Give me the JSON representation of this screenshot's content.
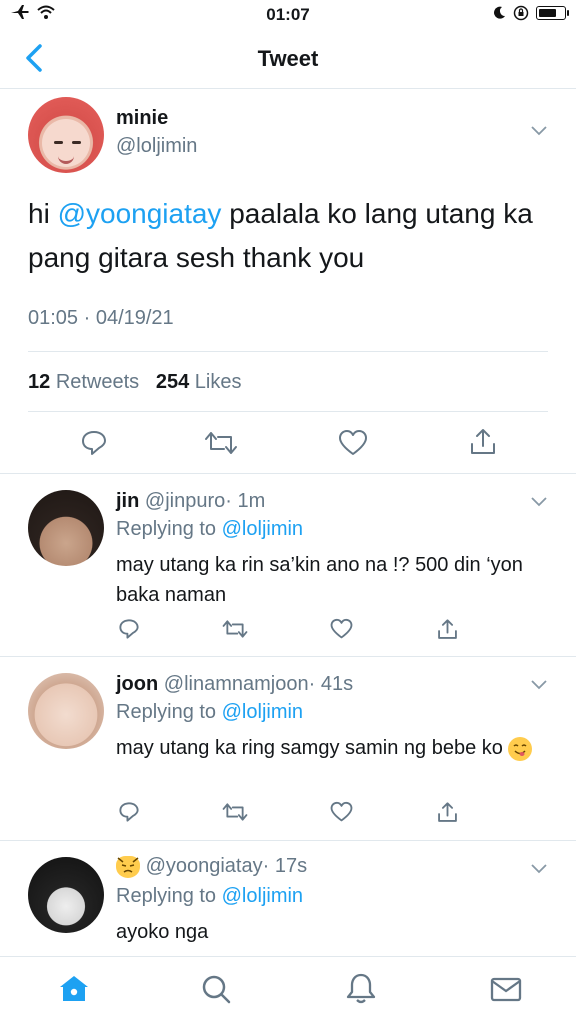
{
  "status_bar": {
    "time": "01:07"
  },
  "nav": {
    "title": "Tweet"
  },
  "tweet": {
    "name": "minie",
    "handle": "@loljimin",
    "text_prefix": "hi ",
    "mention": "@yoongiatay",
    "text_suffix": " paalala ko lang utang ka pang gitara sesh thank you",
    "timestamp": "01:05 · 04/19/21",
    "retweets_count": "12",
    "retweets_label": "Retweets",
    "likes_count": "254",
    "likes_label": "Likes"
  },
  "replies": [
    {
      "name": "jin",
      "handle": "@jinpuro",
      "time": "· 1m",
      "replying_label": "Replying to",
      "replying_to": "@loljimin",
      "text": "may utang ka rin sa’kin ano na !? 500 din ‘yon baka naman"
    },
    {
      "name": "joon",
      "handle": "@linamnamjoon",
      "time": "· 41s",
      "replying_label": "Replying to",
      "replying_to": "@loljimin",
      "text": "may utang ka ring samgy samin ng bebe ko"
    },
    {
      "name": "",
      "handle": "@yoongiatay",
      "time": "· 17s",
      "replying_label": "Replying to",
      "replying_to": "@loljimin",
      "text": "ayoko nga"
    }
  ],
  "colors": {
    "accent": "#1da1f2",
    "secondary_text": "#657786",
    "divider": "#e1e8ed"
  },
  "icons": {
    "reply": "reply-icon",
    "retweet": "retweet-icon",
    "like": "heart-icon",
    "share": "share-icon",
    "home": "home-icon",
    "search": "search-icon",
    "notifications": "bell-icon",
    "messages": "mail-icon"
  }
}
